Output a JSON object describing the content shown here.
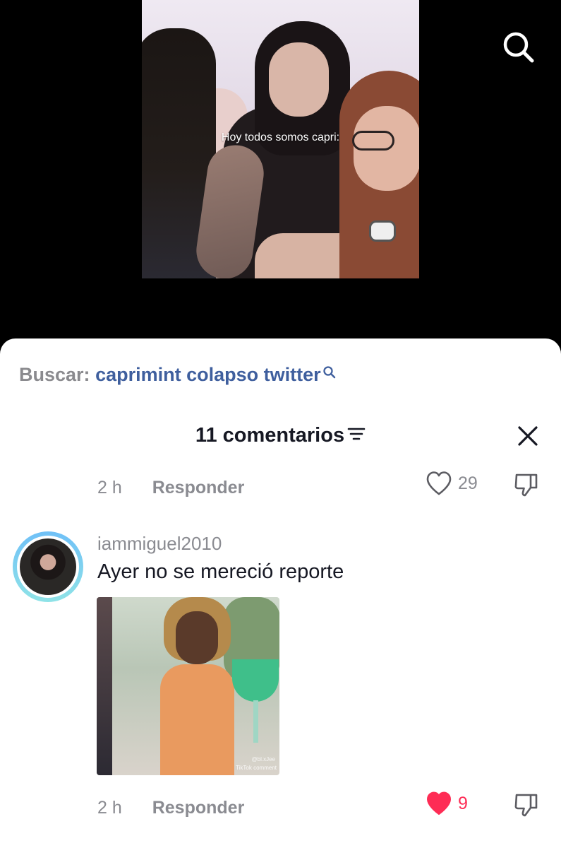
{
  "video": {
    "caption_overlay": "Hoy todos somos capri:"
  },
  "related_search": {
    "prefix": "Buscar:",
    "term": "caprimint colapso twitter"
  },
  "comments_header": {
    "title": "11 comentarios"
  },
  "comments": [
    {
      "time": "2 h",
      "reply_label": "Responder",
      "likes": "29",
      "liked": false
    },
    {
      "username": "iammiguel2010",
      "text": "Ayer no se mereció reporte",
      "attachment": {
        "watermark_handle": "@bl.xJee",
        "watermark_brand": "TikTok comment"
      },
      "time": "2 h",
      "reply_label": "Responder",
      "likes": "9",
      "liked": true
    }
  ],
  "colors": {
    "like_active": "#fe2c55",
    "link_blue": "#3f5f9e",
    "muted_gray": "#8a8b91",
    "avatar_ring": "#6fc0f7"
  },
  "icons": [
    "search-icon",
    "sort-icon",
    "close-icon",
    "heart-icon",
    "dislike-icon"
  ]
}
